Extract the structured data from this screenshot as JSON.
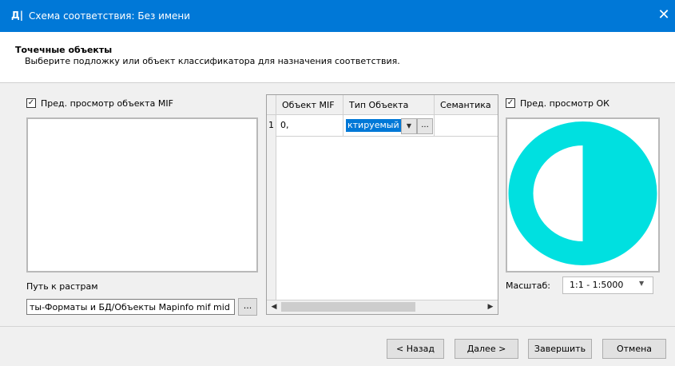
{
  "window": {
    "icon_text": "Д|",
    "title": "Схема соответствия: Без имени",
    "close_glyph": "✕"
  },
  "header": {
    "title": "Точечные объекты",
    "subtitle": "Выберите подложку или объект классификатора для назначения соответствия."
  },
  "left_panel": {
    "preview_checkbox_label": "Пред. просмотр объекта MIF",
    "preview_checked": true,
    "path_label": "Путь к растрам",
    "path_value": "ты-Форматы и БД/Объекты  Mapinfo  mif mid",
    "browse_label": "..."
  },
  "grid": {
    "columns": [
      "Объект MIF",
      "Тип Объекта",
      "Семантика"
    ],
    "rows": [
      {
        "num": "1",
        "mif_object": "0,",
        "object_type": "ктируемый"
      }
    ],
    "combo_arrow": "▼",
    "combo_dots": "..."
  },
  "right_panel": {
    "preview_checkbox_label": "Пред. просмотр ОК",
    "preview_checked": true,
    "preview_fill_color": "#00e0e0",
    "scale_label": "Масштаб:",
    "scale_value": "1:1 - 1:5000"
  },
  "buttons": {
    "back": "< Назад",
    "next": "Далее >",
    "finish": "Завершить",
    "cancel": "Отмена"
  },
  "colors": {
    "titlebar": "#0078d7",
    "selection": "#0078d7",
    "symbol": "#00e0e0"
  }
}
